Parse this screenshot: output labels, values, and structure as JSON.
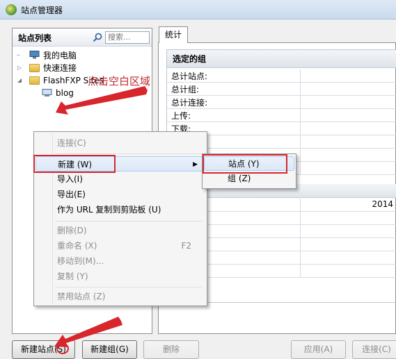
{
  "window": {
    "title": "站点管理器"
  },
  "site_list": {
    "header": "站点列表",
    "search_placeholder": "搜索...",
    "tree": [
      {
        "label": "我的电脑"
      },
      {
        "label": "快速连接"
      },
      {
        "label": "FlashFXP Sites"
      },
      {
        "label": "blog"
      }
    ]
  },
  "annotation": "点击空白区域",
  "tabs": [
    {
      "label": "统计"
    }
  ],
  "stats": {
    "group_header": "选定的组",
    "rows": [
      {
        "label": "总计站点:",
        "value": ""
      },
      {
        "label": "总计组:",
        "value": ""
      },
      {
        "label": "总计连接:",
        "value": ""
      },
      {
        "label": "上传:",
        "value": ""
      },
      {
        "label": "下载:",
        "value": ""
      }
    ],
    "second_section_value": "2014"
  },
  "context_menu": {
    "items": [
      {
        "label": "连接(C)",
        "disabled": true
      },
      {
        "label": "新建 (W)",
        "submenu": true
      },
      {
        "label": "导入(I)"
      },
      {
        "label": "导出(E)"
      },
      {
        "label": "作为 URL 复制到剪贴板 (U)"
      },
      {
        "label": "删除(D)",
        "disabled": true
      },
      {
        "label": "重命名 (X)",
        "shortcut": "F2",
        "disabled": true
      },
      {
        "label": "移动到(M)...",
        "disabled": true
      },
      {
        "label": "复制 (Y)",
        "disabled": true
      },
      {
        "label": "禁用站点 (Z)",
        "disabled": true
      }
    ]
  },
  "submenu": {
    "items": [
      {
        "label": "站点 (Y)"
      },
      {
        "label": "组 (Z)"
      }
    ]
  },
  "buttons": {
    "new_site": "新建站点(S)",
    "new_group": "新建组(G)",
    "delete": "删除",
    "apply": "应用(A)",
    "connect": "连接(C)"
  },
  "colors": {
    "annotation_red": "#d7262c"
  }
}
